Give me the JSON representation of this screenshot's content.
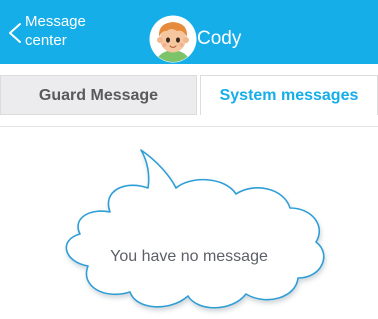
{
  "header": {
    "back_label": "Message center",
    "contact_name": "Cody",
    "background_color": "#15aee8"
  },
  "tabs": [
    {
      "label": "Guard Message",
      "selected": false
    },
    {
      "label": "System messages",
      "selected": true
    }
  ],
  "empty_state": {
    "message": "You have no message"
  },
  "icons": {
    "back": "chevron-left-icon",
    "avatar": "child-avatar-icon"
  },
  "accent_color": "#15aee8"
}
